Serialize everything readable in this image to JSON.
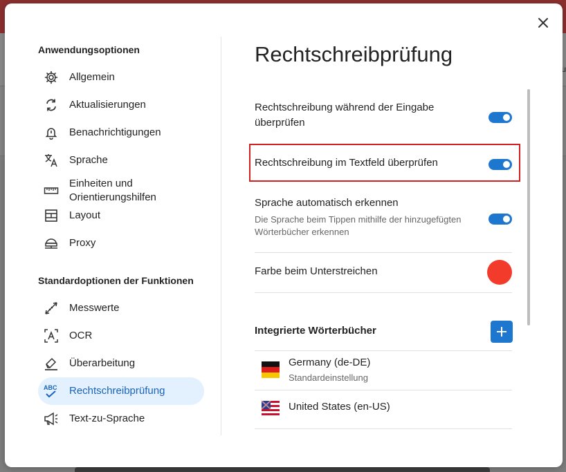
{
  "background": {
    "edge_text": "u"
  },
  "dialog": {
    "close_label": "close"
  },
  "sidebar": {
    "section1_title": "Anwendungsoptionen",
    "section1_items": [
      {
        "label": "Allgemein",
        "icon": "gear-icon"
      },
      {
        "label": "Aktualisierungen",
        "icon": "refresh-icon"
      },
      {
        "label": "Benachrichtigungen",
        "icon": "bell-icon"
      },
      {
        "label": "Sprache",
        "icon": "translate-icon"
      },
      {
        "label": "Einheiten und Orientierungshilfen",
        "icon": "ruler-icon"
      },
      {
        "label": "Layout",
        "icon": "layout-icon"
      },
      {
        "label": "Proxy",
        "icon": "proxy-icon"
      }
    ],
    "section2_title": "Standardoptionen der Funktionen",
    "section2_items": [
      {
        "label": "Messwerte",
        "icon": "measure-icon"
      },
      {
        "label": "OCR",
        "icon": "ocr-icon"
      },
      {
        "label": "Überarbeitung",
        "icon": "eraser-icon"
      },
      {
        "label": "Rechtschreibprüfung",
        "icon": "spellcheck-icon",
        "active": true
      },
      {
        "label": "Text-zu-Sprache",
        "icon": "megaphone-icon"
      }
    ]
  },
  "main": {
    "title": "Rechtschreibprüfung",
    "settings": [
      {
        "label": "Rechtschreibung während der Eingabe überprüfen",
        "enabled": true
      },
      {
        "label": "Rechtschreibung im Textfeld überprüfen",
        "enabled": true
      },
      {
        "label": "Sprache automatisch erkennen",
        "sublabel": "Die Sprache beim Tippen mithilfe der hinzugefügten Wörterbücher erkennen",
        "enabled": true
      }
    ],
    "underline_color_label": "Farbe beim Unterstreichen",
    "underline_color": "#f33b2b",
    "dictionaries_title": "Integrierte Wörterbücher",
    "dictionaries": [
      {
        "name": "Germany (de-DE)",
        "sublabel": "Standardeinstellung",
        "flag": "germany-flag-icon"
      },
      {
        "name": "United States (en-US)",
        "flag": "us-flag-icon"
      }
    ]
  },
  "colors": {
    "accent": "#1e77cf",
    "active_nav_bg": "#e3f0fd",
    "highlight_border": "#d21f1f"
  }
}
